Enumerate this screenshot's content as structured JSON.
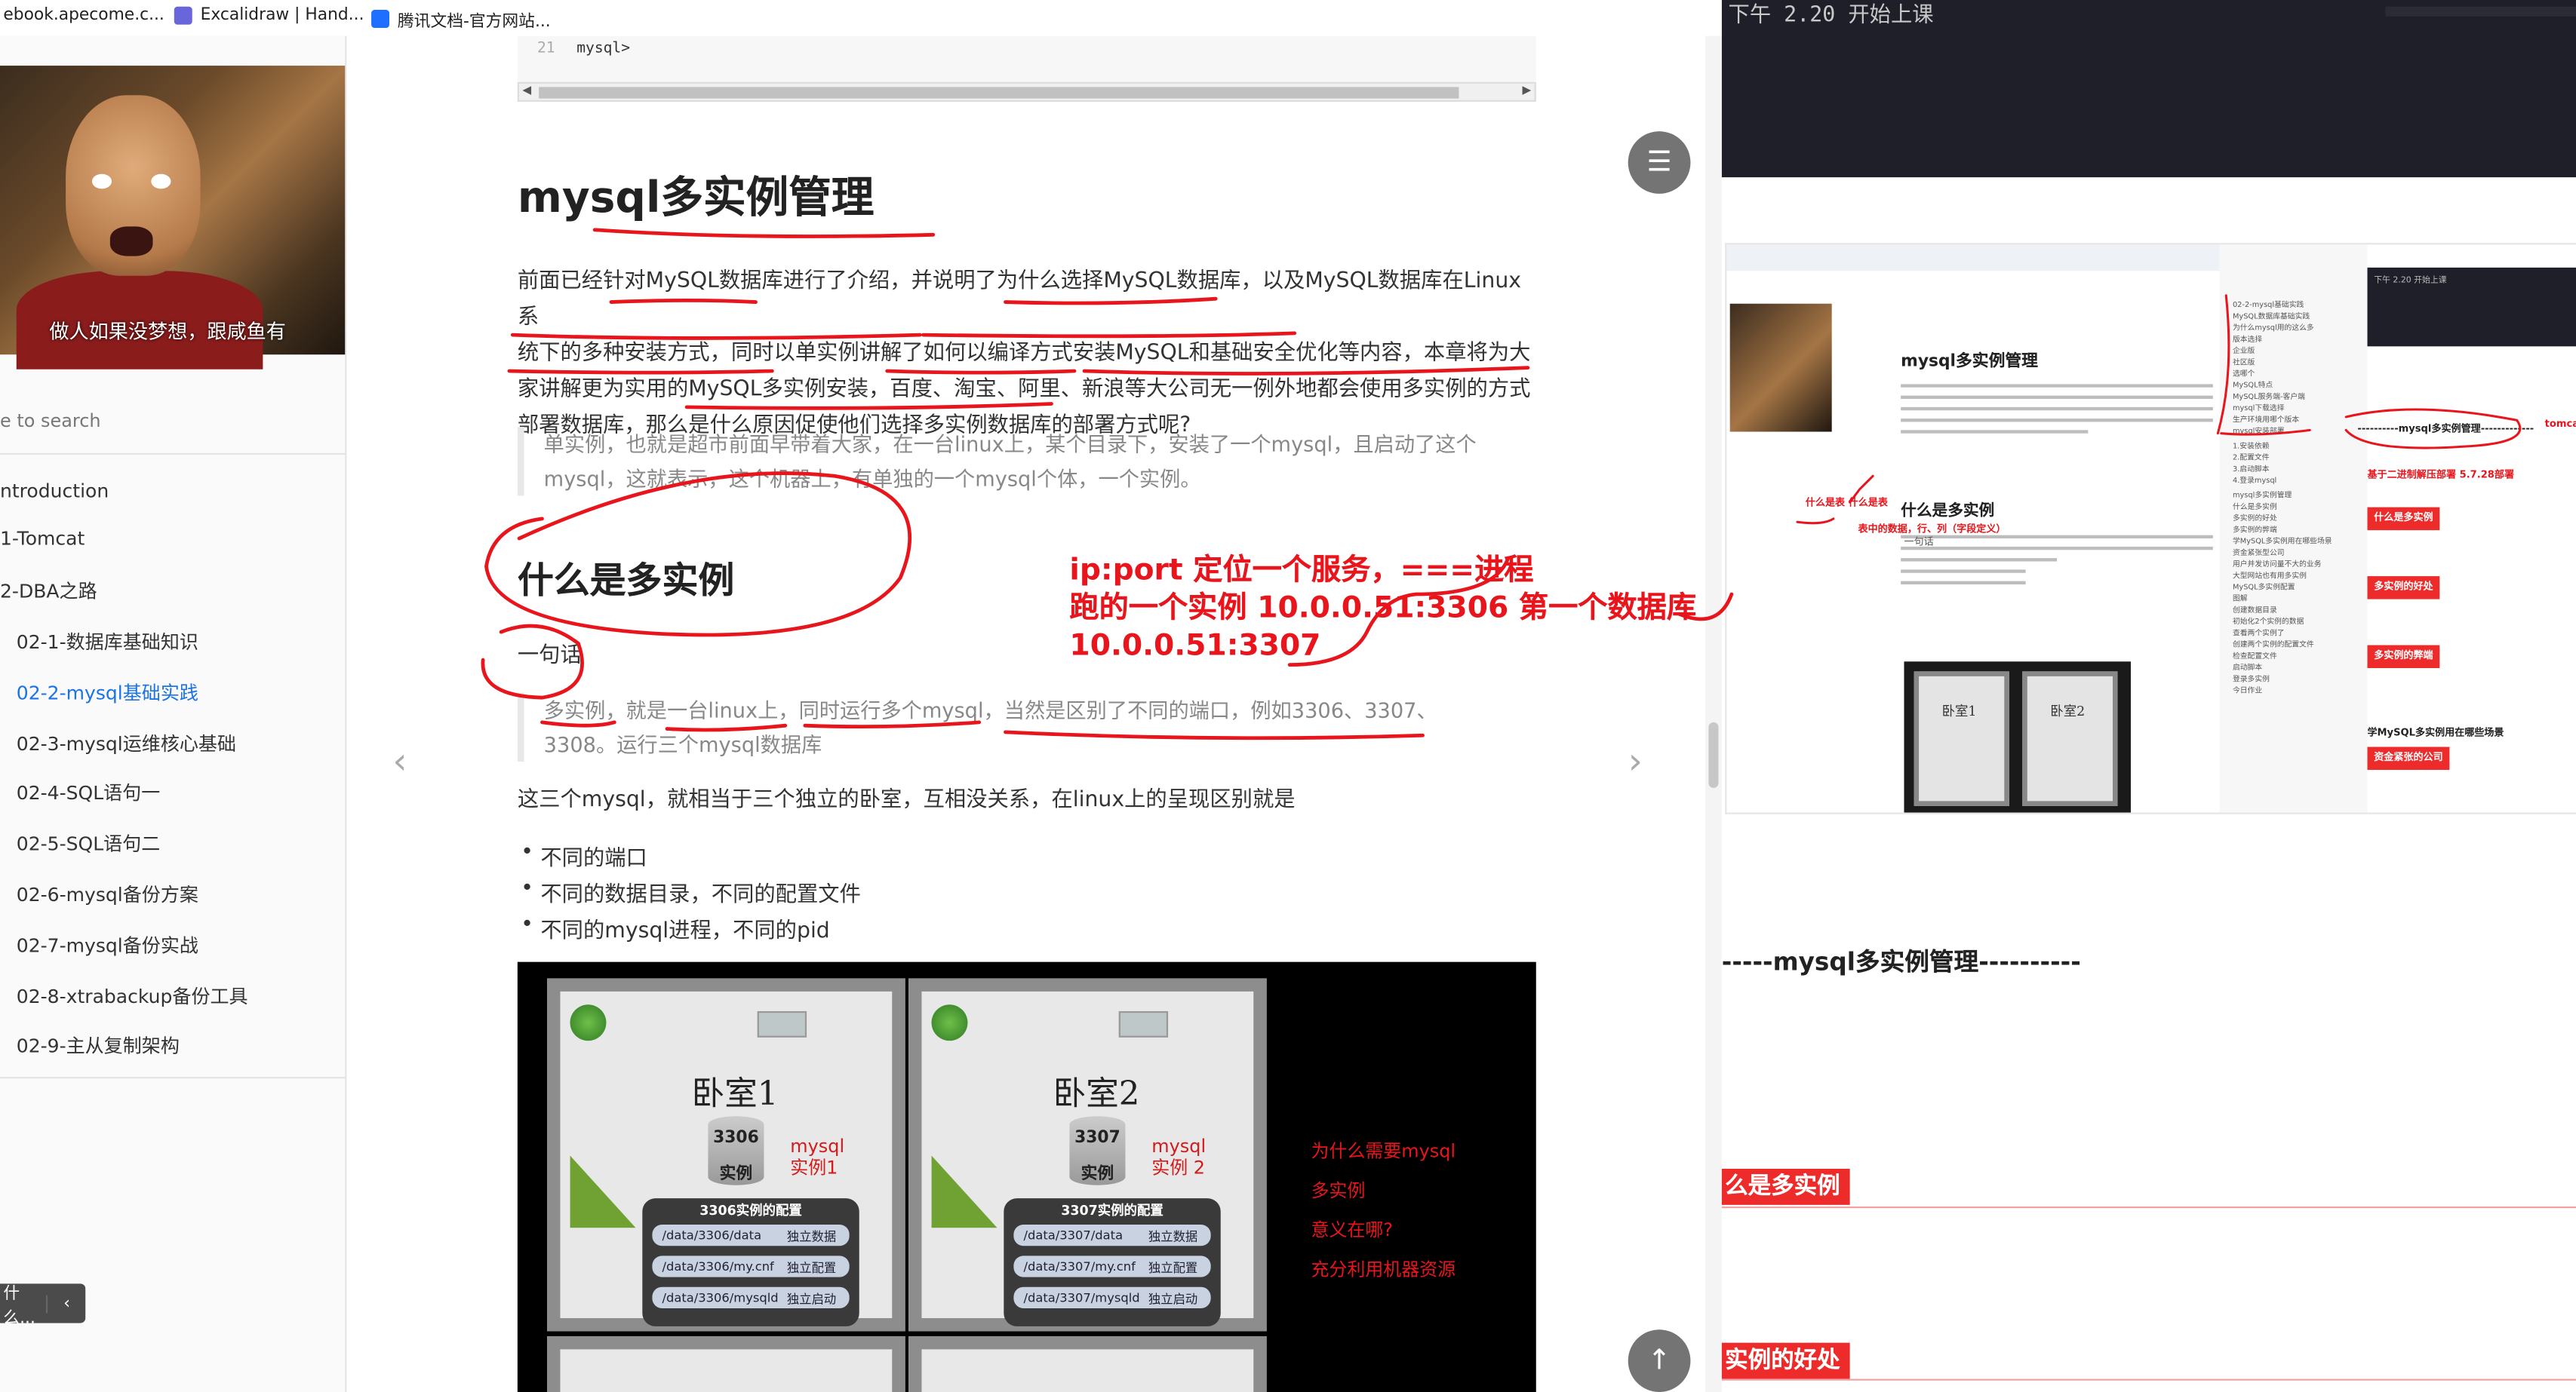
{
  "bookmarks": [
    {
      "label": "ebook.apecome.c...",
      "color": "#2b7be4"
    },
    {
      "label": "Excalidraw | Hand...",
      "color": "#6965db"
    },
    {
      "label": "腾讯文档-官方网站...",
      "color": "#1e6fff"
    }
  ],
  "sidebar": {
    "avatar_caption": "做人如果没梦想，跟咸鱼有",
    "search_placeholder": "e to search",
    "items": [
      {
        "label": "ntroduction"
      },
      {
        "label": "1-Tomcat"
      },
      {
        "label": "2-DBA之路"
      },
      {
        "label": "02-1-数据库基础知识"
      },
      {
        "label": "02-2-mysql基础实践"
      },
      {
        "label": "02-3-mysql运维核心基础"
      },
      {
        "label": "02-4-SQL语句一"
      },
      {
        "label": "02-5-SQL语句二"
      },
      {
        "label": "02-6-mysql备份方案"
      },
      {
        "label": "02-7-mysql备份实战"
      },
      {
        "label": "02-8-xtrabackup备份工具"
      },
      {
        "label": "02-9-主从复制架构"
      }
    ],
    "collapse_text": "什么...",
    "collapse_icon": "chevron-left-icon"
  },
  "article": {
    "code_line_no": "21",
    "code_line": "mysql>",
    "h1": "mysql多实例管理",
    "intro_lines": [
      "前面已经针对MySQL数据库进行了介绍，并说明了为什么选择MySQL数据库，以及MySQL数据库在Linux系",
      "统下的多种安装方式，同时以单实例讲解了如何以编译方式安装MySQL和基础安全优化等内容，本章将为大",
      "家讲解更为实用的MySQL多实例安装，百度、淘宝、阿里、新浪等大公司无一例外地都会使用多实例的方式",
      "部署数据库，那么是什么原因促使他们选择多实例数据库的部署方式呢?"
    ],
    "quote1_lines": [
      "单实例，也就是超市前面早带着大家，在一台linux上，某个目录下，安装了一个mysql，且启动了这个",
      "mysql，这就表示，这个机器上，有单独的一个mysql个体，一个实例。"
    ],
    "h2": "什么是多实例",
    "one_sentence": "一句话",
    "quote2_lines": [
      "多实例，就是一台linux上，同时运行多个mysql，当然是区别了不同的端口，例如3306、3307、",
      "3308。运行三个mysql数据库"
    ],
    "para2": "这三个mysql，就相当于三个独立的卧室，互相没关系，在linux上的呈现区别就是",
    "bullets": [
      "不同的端口",
      "不同的数据目录，不同的配置文件",
      "不同的mysql进程，不同的pid"
    ],
    "annotation_lines": [
      "ip:port 定位一个服务，===进程",
      "跑的一个实例 10.0.0.51:3306 第一个数据库",
      "10.0.0.51:3307"
    ],
    "diagram": {
      "rooms": [
        {
          "title": "卧室1",
          "port": "3306",
          "inst_word": "实例",
          "label1": "mysql",
          "label2": "实例1",
          "cfg_title": "3306实例的配置",
          "rows": [
            [
              "/data/3306/data",
              "独立数据"
            ],
            [
              "/data/3306/my.cnf",
              "独立配置"
            ],
            [
              "/data/3306/mysqld",
              "独立启动"
            ]
          ]
        },
        {
          "title": "卧室2",
          "port": "3307",
          "inst_word": "实例",
          "label1": "mysql",
          "label2": "实例 2",
          "cfg_title": "3307实例的配置",
          "rows": [
            [
              "/data/3307/data",
              "独立数据"
            ],
            [
              "/data/3307/my.cnf",
              "独立配置"
            ],
            [
              "/data/3307/mysqld",
              "独立启动"
            ]
          ]
        }
      ],
      "notes": [
        "为什么需要mysql",
        "多实例",
        "意义在哪?",
        "充分利用机器资源"
      ]
    }
  },
  "controls": {
    "menu_icon": "hamburger-menu-icon",
    "top_icon": "arrow-up-icon",
    "prev_icon": "chevron-left-icon",
    "next_icon": "chevron-right-icon"
  },
  "right_panel": {
    "terminal_text": "下午 2.20 开始上课",
    "mini_h1": "mysql多实例管理",
    "mini_h2": "什么是多实例",
    "mini_rooms": [
      "卧室1",
      "卧室2"
    ],
    "mini_term_text": "下午 2.20 开始上课",
    "mini_toc": [
      "02-2-mysql基础实践",
      "MySQL数据库基础实践",
      "为什么mysql用的这么多",
      "版本选择",
      "企业版",
      "社区版",
      "选哪个",
      "MySQL特点",
      "MySQL服务端-客户端",
      "mysql下载选择",
      "生产环境用哪个版本",
      "mysql安装部署",
      "1.安装依赖",
      "2.配置文件",
      "3.启动脚本",
      "4.登录mysql",
      "mysql多实例管理",
      "什么是多实例",
      "多实例的好处",
      "多实例的弊端",
      "学MySQL多实例用在哪些场景",
      "资金紧张型公司",
      "用户并发访问量不大的业务",
      "大型网站也有用多实例",
      "MySQL多实例配置",
      "图解",
      "创建数据目录",
      "初始化2个实例的数据",
      "查看两个实例了",
      "创建两个实例的配置文件",
      "检查配置文件",
      "启动脚本",
      "登录多实例",
      "今日作业"
    ],
    "notes": {
      "what": "什么是表 什么是表",
      "table": "表中的数据，行、列（字段定义）",
      "manage": "----------mysql多实例管理-------------",
      "tomcat": "tomca",
      "binary": "基于二进制解压部署 5.7.28部署",
      "one": "一句话"
    },
    "pills": [
      "什么是多实例",
      "多实例的好处",
      "多实例的弊端",
      "资金紧张的公司"
    ],
    "scene": "学MySQL多实例用在哪些场景",
    "big_heading": "-----mysql多实例管理----------",
    "band1": "么是多实例",
    "band2": "实例的好处"
  },
  "colors": {
    "accent_red": "#e8161c",
    "link_blue": "#1a73e8",
    "fab_gray": "#747474"
  }
}
